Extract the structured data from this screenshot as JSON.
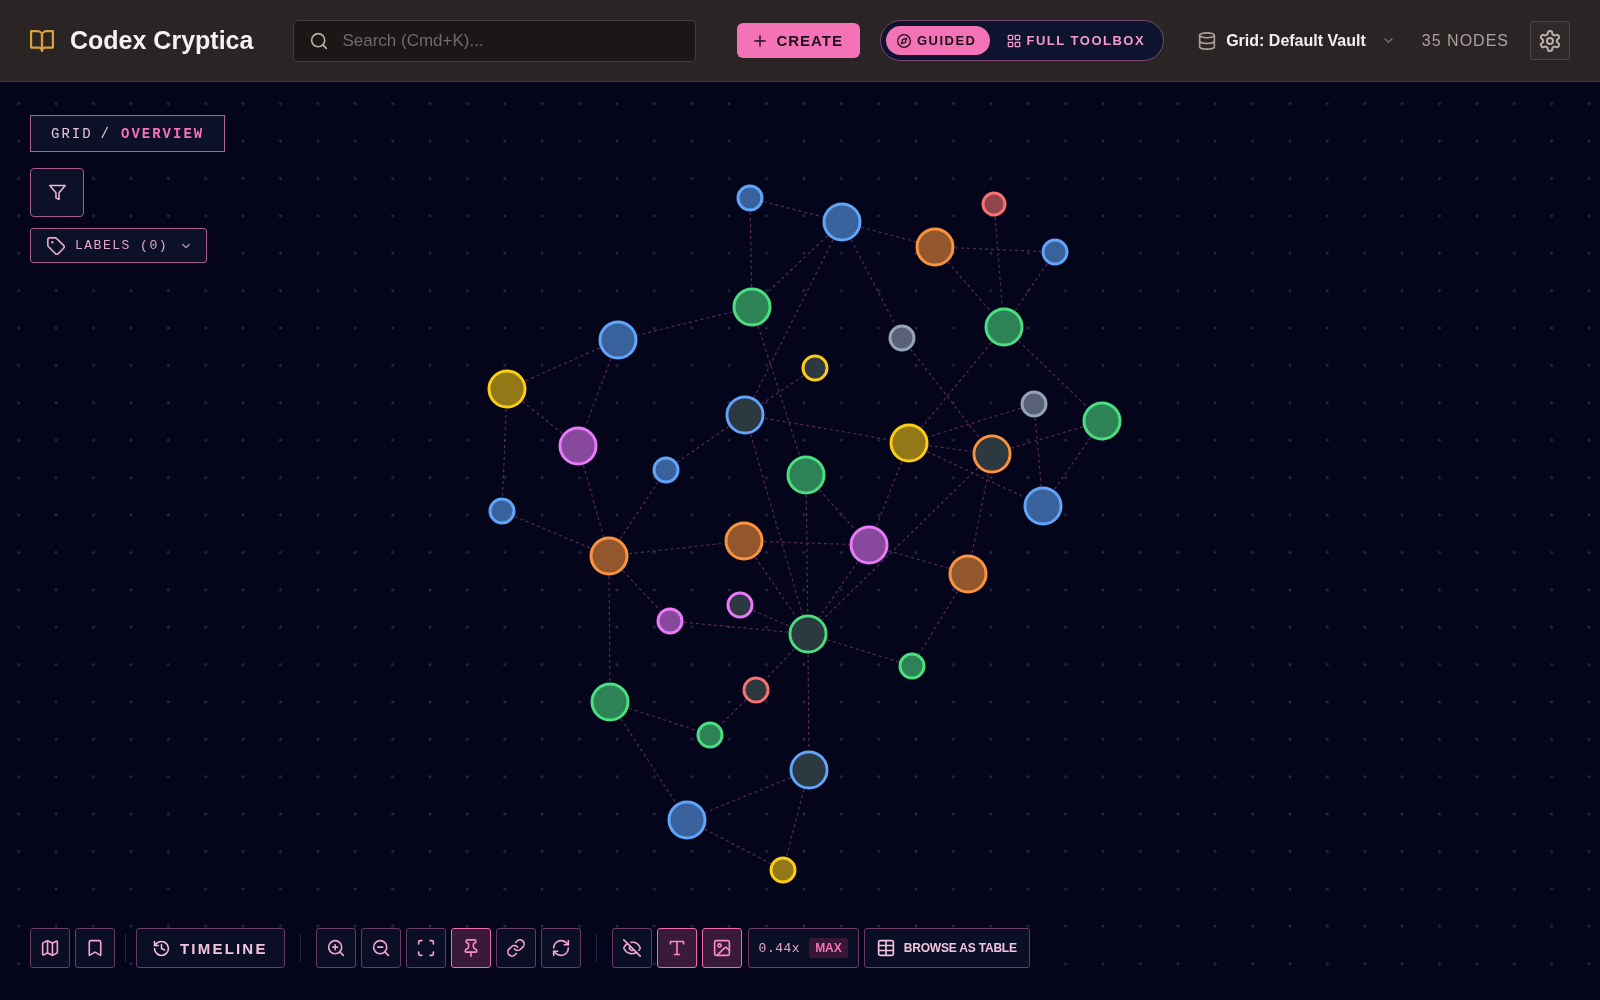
{
  "header": {
    "title": "Codex Cryptica",
    "search": {
      "placeholder": "Search (Cmd+K)..."
    },
    "create_button": {
      "label": "CREATE"
    },
    "mode_toggle": [
      {
        "label": "GUIDED",
        "selected": true
      },
      {
        "label": "FULL TOOLBOX",
        "selected": false
      }
    ],
    "vault": {
      "label": "Grid: Default Vault"
    },
    "node_count": "35 NODES"
  },
  "canvas": {
    "breadcrumb": {
      "items": [
        {
          "label": "GRID",
          "current": false
        },
        {
          "label": "OVERVIEW",
          "current": true
        }
      ],
      "separator": "/"
    },
    "labels_filter": {
      "label": "LABELS (0)"
    },
    "graph": {
      "nodes": [
        {
          "color": "#60a5fa",
          "kind": "plain"
        },
        {
          "color": "#60a5fa",
          "kind": "plain"
        },
        {
          "color": "#f87171",
          "kind": "plain"
        },
        {
          "color": "#fb923c",
          "kind": "plain"
        },
        {
          "color": "#60a5fa",
          "kind": "plain"
        },
        {
          "color": "#4ade80",
          "kind": "plain"
        },
        {
          "color": "#60a5fa",
          "kind": "plain"
        },
        {
          "color": "#94a3b8",
          "kind": "plain"
        },
        {
          "color": "#4ade80",
          "kind": "plain"
        },
        {
          "color": "#facc15",
          "kind": "image"
        },
        {
          "color": "#facc15",
          "kind": "plain"
        },
        {
          "color": "#60a5fa",
          "kind": "image"
        },
        {
          "color": "#94a3b8",
          "kind": "plain"
        },
        {
          "color": "#4ade80",
          "kind": "plain"
        },
        {
          "color": "#e879f9",
          "kind": "plain"
        },
        {
          "color": "#facc15",
          "kind": "plain"
        },
        {
          "color": "#fb923c",
          "kind": "image"
        },
        {
          "color": "#60a5fa",
          "kind": "plain"
        },
        {
          "color": "#4ade80",
          "kind": "plain"
        },
        {
          "color": "#60a5fa",
          "kind": "plain"
        },
        {
          "color": "#60a5fa",
          "kind": "plain"
        },
        {
          "color": "#fb923c",
          "kind": "plain"
        },
        {
          "color": "#fb923c",
          "kind": "plain"
        },
        {
          "color": "#e879f9",
          "kind": "plain"
        },
        {
          "color": "#fb923c",
          "kind": "plain"
        },
        {
          "color": "#e879f9",
          "kind": "image"
        },
        {
          "color": "#e879f9",
          "kind": "plain"
        },
        {
          "color": "#4ade80",
          "kind": "image"
        },
        {
          "color": "#4ade80",
          "kind": "plain"
        },
        {
          "color": "#f87171",
          "kind": "image"
        },
        {
          "color": "#4ade80",
          "kind": "plain"
        },
        {
          "color": "#4ade80",
          "kind": "plain"
        },
        {
          "color": "#60a5fa",
          "kind": "image"
        },
        {
          "color": "#60a5fa",
          "kind": "plain"
        },
        {
          "color": "#facc15",
          "kind": "plain"
        }
      ]
    },
    "toolbar": {
      "timeline_button": {
        "label": "TIMELINE"
      },
      "view_tools": [
        {
          "active": false
        },
        {
          "active": false
        },
        {
          "active": false
        },
        {
          "active": true
        },
        {
          "active": false
        },
        {
          "active": false
        }
      ],
      "display_toggles": [
        {
          "on": false
        },
        {
          "on": true
        },
        {
          "on": true
        }
      ],
      "zoom": {
        "value": "0.44x",
        "badge": "MAX"
      },
      "table_button": {
        "label": "BROWSE AS TABLE"
      }
    }
  }
}
